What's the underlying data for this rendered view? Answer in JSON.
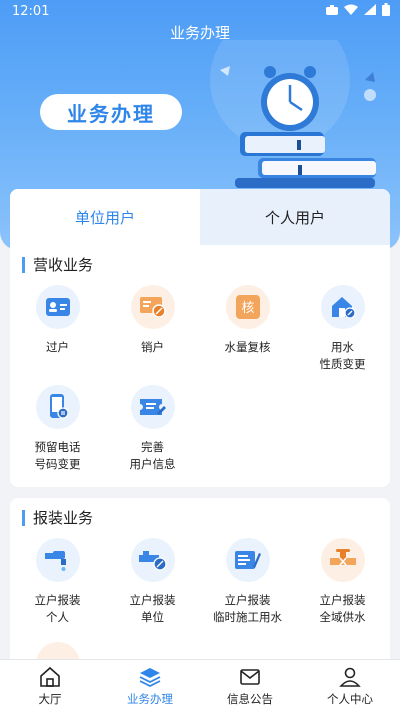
{
  "status_bar": {
    "time": "12:01"
  },
  "header": {
    "title": "业务办理",
    "banner_label": "业务办理"
  },
  "tabs": [
    {
      "label": "单位用户",
      "active": true
    },
    {
      "label": "个人用户",
      "active": false
    }
  ],
  "sections": [
    {
      "title": "营收业务",
      "items": [
        {
          "label": "过户",
          "icon": "id-card-icon"
        },
        {
          "label": "销户",
          "icon": "card-cancel-icon"
        },
        {
          "label": "水量复核",
          "icon": "verify-icon"
        },
        {
          "label": "用水\n性质变更",
          "icon": "house-water-icon"
        },
        {
          "label": "预留电话\n号码变更",
          "icon": "phone-icon"
        },
        {
          "label": "完善\n用户信息",
          "icon": "ticket-icon"
        }
      ]
    },
    {
      "title": "报装业务",
      "items": [
        {
          "label": "立户报装\n个人",
          "icon": "faucet-icon"
        },
        {
          "label": "立户报装\n单位",
          "icon": "pipe-icon"
        },
        {
          "label": "立户报装\n临时施工用水",
          "icon": "form-icon"
        },
        {
          "label": "立户报装\n全域供水",
          "icon": "valve-icon"
        }
      ]
    }
  ],
  "bottom_nav": [
    {
      "label": "大厅",
      "icon": "home-icon",
      "active": false
    },
    {
      "label": "业务办理",
      "icon": "layers-icon",
      "active": true
    },
    {
      "label": "信息公告",
      "icon": "mail-icon",
      "active": false
    },
    {
      "label": "个人中心",
      "icon": "user-icon",
      "active": false
    }
  ],
  "colors": {
    "accent": "#2f86ea",
    "hero_top": "#4d9cf6",
    "orange": "#f59b4c"
  }
}
